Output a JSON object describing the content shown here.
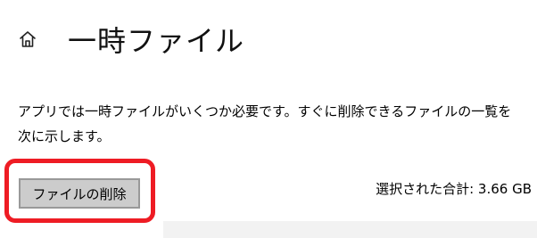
{
  "header": {
    "home_icon": "home-icon",
    "title": "一時ファイル"
  },
  "description": {
    "line1": "アプリでは一時ファイルがいくつか必要です。すぐに削除できるファイルの一覧を",
    "line2": "次に示します。"
  },
  "actions": {
    "delete_button_label": "ファイルの削除",
    "highlight_color": "#ee1c24"
  },
  "summary": {
    "selected_total": "選択された合計: 3.66 GB"
  }
}
